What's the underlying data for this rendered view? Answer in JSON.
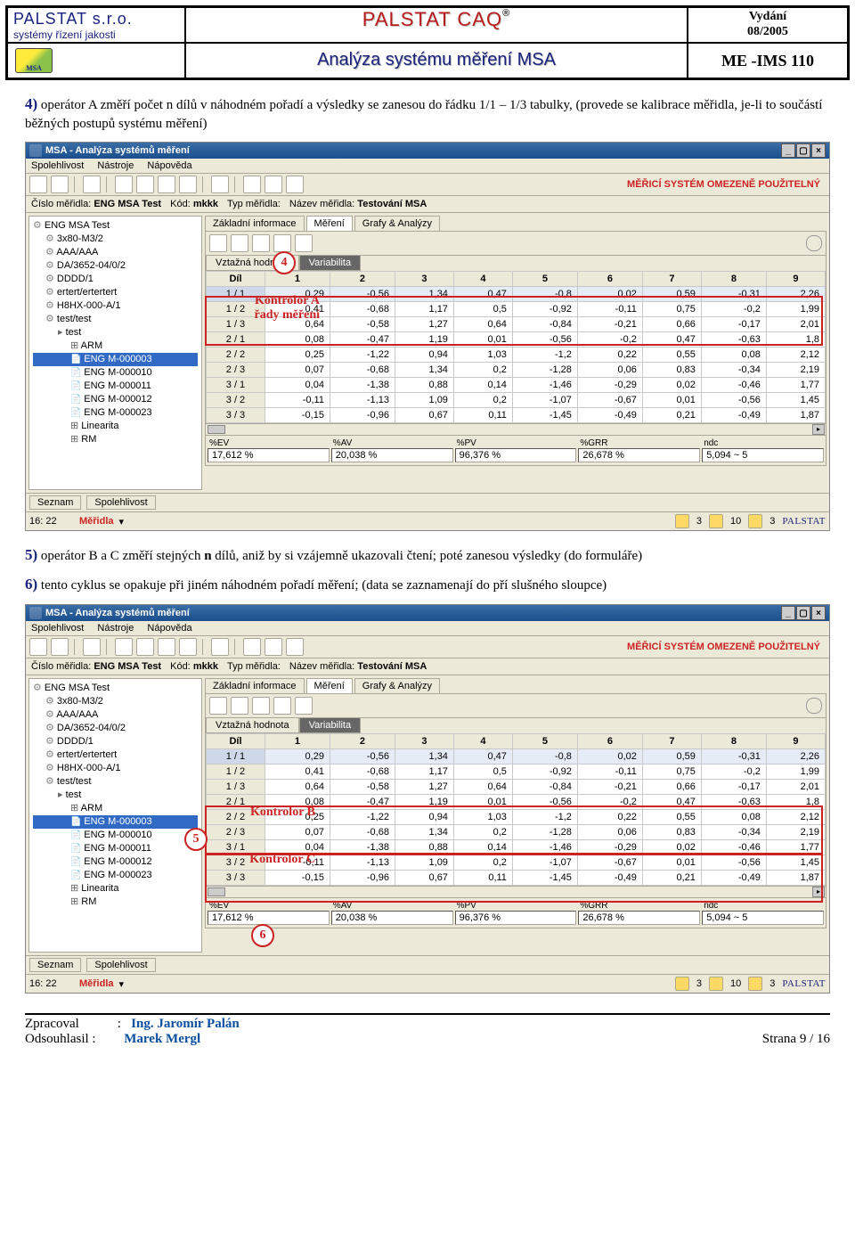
{
  "header": {
    "company": "PALSTAT s.r.o.",
    "company_sub": "systémy řízení jakosti",
    "msa_icon": "MSA",
    "title_main": "PALSTAT CAQ",
    "title_reg": "®",
    "subtitle": "Analýza systému měření MSA",
    "issue_label": "Vydání",
    "issue_date": "08/2005",
    "doc_code": "ME -IMS 110"
  },
  "para4": {
    "num": "4)",
    "text": " operátor A změří počet n dílů v náhodném pořadí a výsledky se zanesou do řádku 1/1 – 1/3 tabulky, (provede se kalibrace měřidla, je-li to součástí běžných postupů systému měření)"
  },
  "para5": {
    "num": "5)",
    "text_a": " operátor B a C změří stejných ",
    "nbold": "n",
    "text_b": " dílů, aniž by si vzájemně ukazovali čtení; poté zanesou výsledky (do formuláře)"
  },
  "para6": {
    "num": "6)",
    "text": " tento cyklus se opakuje při jiném náhodném pořadí měření; (data se zaznamenají do pří slušného sloupce)"
  },
  "app": {
    "title": "MSA - Analýza systémů měření",
    "menu": [
      "Spolehlivost",
      "Nástroje",
      "Nápověda"
    ],
    "status_right": "MĚŘICÍ SYSTÉM OMEZENĚ POUŽITELNÝ",
    "info": {
      "cislo_lbl": "Číslo měřidla:",
      "cislo": "ENG MSA Test",
      "kod_lbl": "Kód:",
      "kod": "mkkk",
      "typ_lbl": "Typ měřidla:",
      "nazev_lbl": "Název měřidla:",
      "nazev": "Testování MSA"
    },
    "tabs": [
      "Základní informace",
      "Měření",
      "Grafy & Analýzy"
    ],
    "subtabs": [
      "Vztažná hodnota",
      "Variabilita"
    ],
    "grid_head": [
      "Díl",
      "1",
      "2",
      "3",
      "4",
      "5",
      "6",
      "7",
      "8",
      "9"
    ],
    "grid_rows": [
      [
        "1 / 1",
        "0,29",
        "-0,56",
        "1,34",
        "0,47",
        "-0,8",
        "0,02",
        "0,59",
        "-0,31",
        "2,26"
      ],
      [
        "1 / 2",
        "0,41",
        "-0,68",
        "1,17",
        "0,5",
        "-0,92",
        "-0,11",
        "0,75",
        "-0,2",
        "1,99"
      ],
      [
        "1 / 3",
        "0,64",
        "-0,58",
        "1,27",
        "0,64",
        "-0,84",
        "-0,21",
        "0,66",
        "-0,17",
        "2,01"
      ],
      [
        "2 / 1",
        "0,08",
        "-0,47",
        "1,19",
        "0,01",
        "-0,56",
        "-0,2",
        "0,47",
        "-0,63",
        "1,8"
      ],
      [
        "2 / 2",
        "0,25",
        "-1,22",
        "0,94",
        "1,03",
        "-1,2",
        "0,22",
        "0,55",
        "0,08",
        "2,12"
      ],
      [
        "2 / 3",
        "0,07",
        "-0,68",
        "1,34",
        "0,2",
        "-1,28",
        "0,06",
        "0,83",
        "-0,34",
        "2,19"
      ],
      [
        "3 / 1",
        "0,04",
        "-1,38",
        "0,88",
        "0,14",
        "-1,46",
        "-0,29",
        "0,02",
        "-0,46",
        "1,77"
      ],
      [
        "3 / 2",
        "-0,11",
        "-1,13",
        "1,09",
        "0,2",
        "-1,07",
        "-0,67",
        "0,01",
        "-0,56",
        "1,45"
      ],
      [
        "3 / 3",
        "-0,15",
        "-0,96",
        "0,67",
        "0,11",
        "-1,45",
        "-0,49",
        "0,21",
        "-0,49",
        "1,87"
      ]
    ],
    "stats": {
      "ev_lbl": "%EV",
      "ev": "17,612 %",
      "av_lbl": "%AV",
      "av": "20,038 %",
      "pv_lbl": "%PV",
      "pv": "96,376 %",
      "grr_lbl": "%GRR",
      "grr": "26,678 %",
      "ndc_lbl": "ndc",
      "ndc": "5,094 ~ 5"
    },
    "bottom_tabs": [
      "Seznam",
      "Spolehlivost"
    ],
    "status": {
      "time": "16: 22",
      "mer": "Měřidla",
      "arrow": "▾",
      "r": [
        "3",
        "10",
        "3"
      ],
      "brand": "PALSTAT"
    },
    "tree1": [
      {
        "t": "ENG MSA Test",
        "cls": "col cog"
      },
      {
        "t": "3x80-M3/2",
        "cls": "exp cog lvl1"
      },
      {
        "t": "AAA/AAA",
        "cls": "exp cog lvl1"
      },
      {
        "t": "DA/3652-04/0/2",
        "cls": "exp cog lvl1"
      },
      {
        "t": "DDDD/1",
        "cls": "exp cog lvl1"
      },
      {
        "t": "ertert/ertertert",
        "cls": "exp cog lvl1"
      },
      {
        "t": "H8HX-000-A/1",
        "cls": "exp cog lvl1"
      },
      {
        "t": "test/test",
        "cls": "col cog lvl1"
      },
      {
        "t": "test",
        "cls": "col box lvl2"
      },
      {
        "t": "ARM",
        "cls": "exp lvl3"
      },
      {
        "t": "ENG M-000003",
        "cls": "doc lvl3",
        "sel": true
      },
      {
        "t": "ENG M-000010",
        "cls": "doc lvl3"
      },
      {
        "t": "ENG M-000011",
        "cls": "doc lvl3"
      },
      {
        "t": "ENG M-000012",
        "cls": "doc lvl3"
      },
      {
        "t": "ENG M-000023",
        "cls": "doc lvl3"
      },
      {
        "t": "Linearita",
        "cls": "exp lvl3"
      },
      {
        "t": "RM",
        "cls": "exp lvl3"
      }
    ],
    "tree2": [
      {
        "t": "ENG MSA Test",
        "cls": "col cog"
      },
      {
        "t": "3x80-M3/2",
        "cls": "exp cog lvl1"
      },
      {
        "t": "AAA/AAA",
        "cls": "exp cog lvl1"
      },
      {
        "t": "DA/3652-04/0/2",
        "cls": "exp cog lvl1"
      },
      {
        "t": "DDDD/1",
        "cls": "exp cog lvl1"
      },
      {
        "t": "ertert/ertertert",
        "cls": "exp cog lvl1"
      },
      {
        "t": "H8HX-000-A/1",
        "cls": "exp cog lvl1"
      },
      {
        "t": "test/test",
        "cls": "col cog lvl1"
      },
      {
        "t": "test",
        "cls": "col box lvl2"
      },
      {
        "t": "ARM",
        "cls": "exp lvl3"
      },
      {
        "t": "ENG M-000003",
        "cls": "doc lvl3",
        "sel": true
      },
      {
        "t": "ENG M-000010",
        "cls": "doc lvl3"
      },
      {
        "t": "ENG M-000011",
        "cls": "doc lvl3"
      },
      {
        "t": "ENG M-000012",
        "cls": "doc lvl3"
      },
      {
        "t": "ENG M-000023",
        "cls": "doc lvl3"
      },
      {
        "t": "Linearita",
        "cls": "exp lvl3"
      },
      {
        "t": "RM",
        "cls": "exp lvl3"
      }
    ]
  },
  "annot1": {
    "kontrolor_a": "Kontrolor A",
    "rady": "řady měření",
    "circ4": "4"
  },
  "annot2": {
    "kontrolor_b": "Kontrolor B",
    "kontrolor_c": "Kontrolor C",
    "circ5": "5",
    "circ6": "6"
  },
  "footer": {
    "zprac_lbl": "Zpracoval",
    "colon": ":",
    "zprac_val": "Ing. Jaromír Palán",
    "ods_lbl": "Odsouhlasil :",
    "ods_val": "Marek Mergl",
    "page": "Strana 9 / 16"
  }
}
